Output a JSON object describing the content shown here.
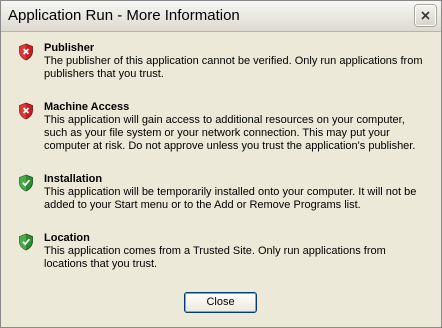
{
  "window": {
    "title": "Application Run - More Information"
  },
  "sections": [
    {
      "heading": "Publisher",
      "text": "The publisher of this application cannot be verified. Only run applications from publishers that you trust.",
      "status": "warning"
    },
    {
      "heading": "Machine Access",
      "text": "This application will gain access to additional resources on your computer, such as your file system or your network connection. This may put your computer at risk. Do not approve unless you trust the application's publisher.",
      "status": "warning"
    },
    {
      "heading": "Installation",
      "text": "This application will be temporarily installed onto your computer. It will not be added to your Start menu or to the Add or Remove Programs list.",
      "status": "ok"
    },
    {
      "heading": "Location",
      "text": "This application comes from a Trusted Site. Only run applications from locations that you trust.",
      "status": "ok"
    }
  ],
  "buttons": {
    "close_label": "Close"
  },
  "colors": {
    "warning_shield": "#c81e1e",
    "ok_shield": "#2e8b2e",
    "button_border": "#003c74"
  }
}
